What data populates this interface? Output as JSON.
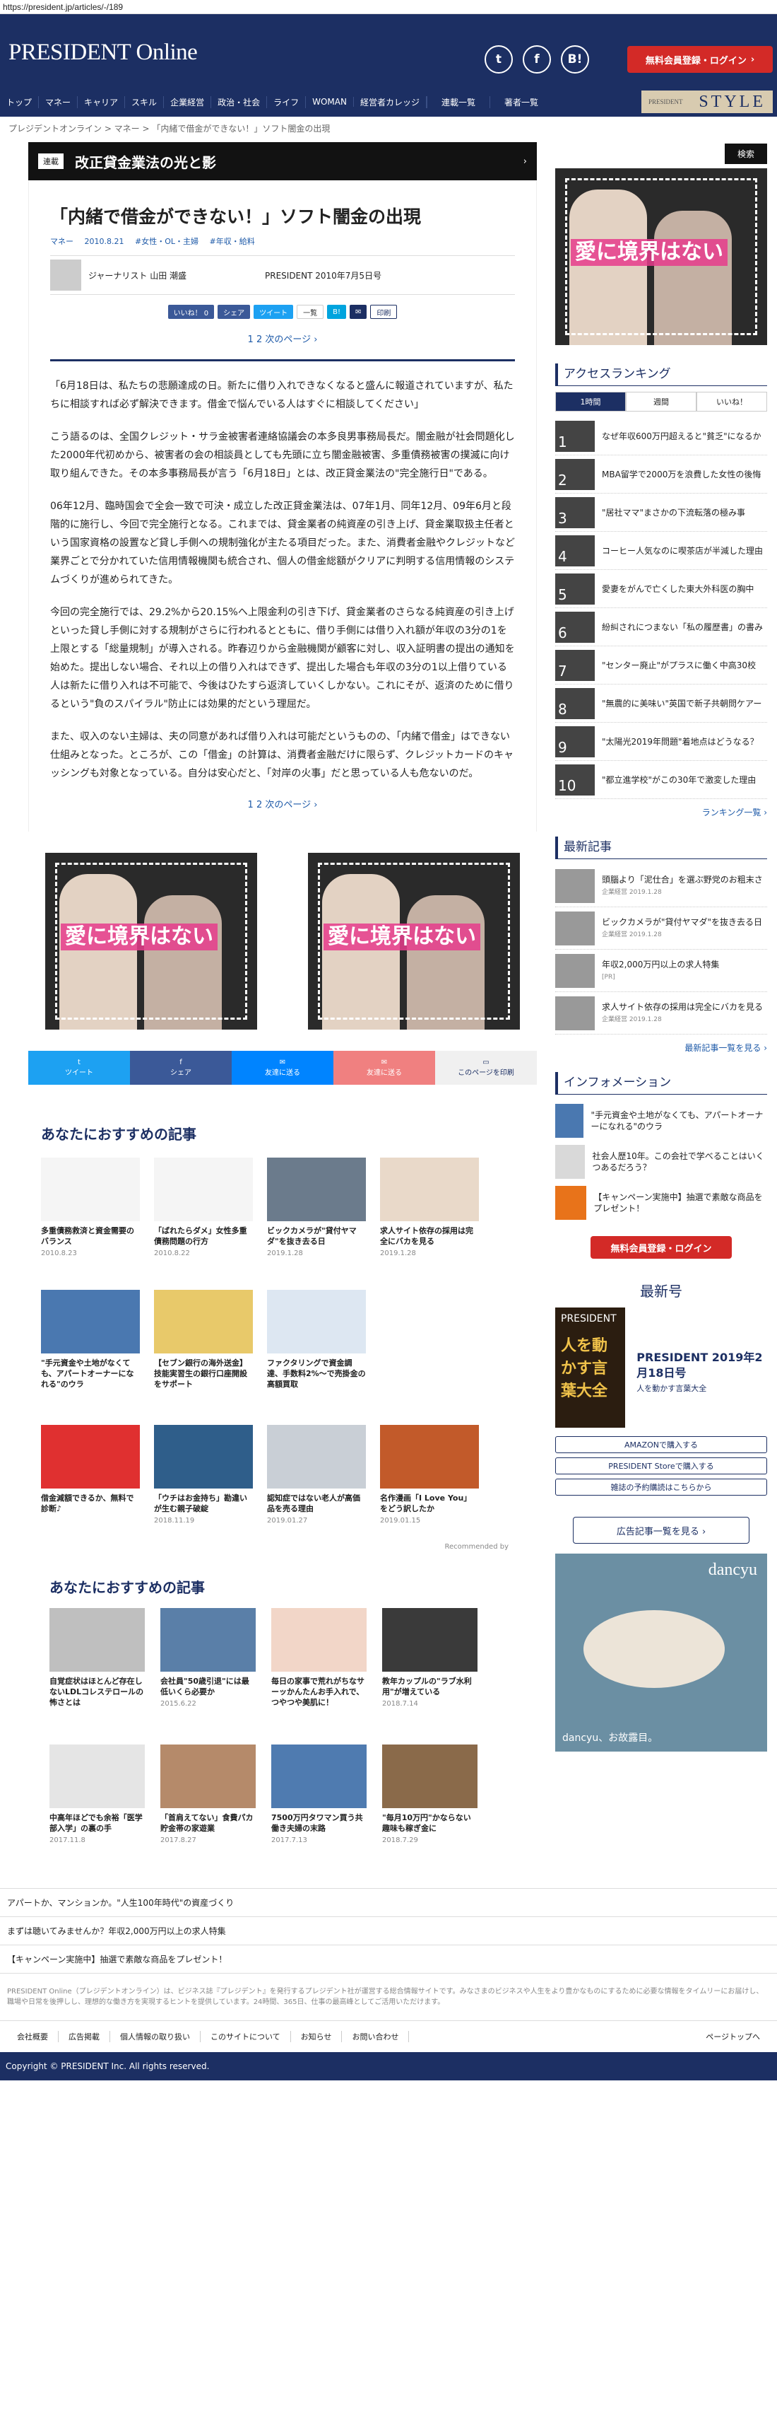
{
  "url": "https://president.jp/articles/-/189",
  "logo": "PRESIDENT Online",
  "register": "無料会員登録・ログイン",
  "nav": [
    "トップ",
    "マネー",
    "キャリア",
    "スキル",
    "企業経営",
    "政治・社会",
    "ライフ",
    "WOMAN",
    "経営者カレッジ"
  ],
  "nav_right": [
    "連載一覧",
    "著者一覧"
  ],
  "style_label": "STYLE",
  "style_small": "PRESIDENT",
  "breadcrumb": "プレジデントオンライン > マネー > 「内緒で借金ができない！」ソフト闇金の出現",
  "series_tag": "連載",
  "series_title": "改正貸金業法の光と影",
  "title": "「内緒で借金ができない！」ソフト闇金の出現",
  "meta": [
    "マネー",
    "2010.8.21",
    "#女性・OL・主婦",
    "#年収・給料"
  ],
  "author": "ジャーナリスト 山田 潮盛",
  "source": "PRESIDENT 2010年7月5日号",
  "share_buttons": [
    "いいね！ 0",
    "シェア",
    "ツイート",
    "一覧",
    "B!",
    "✉",
    "印刷"
  ],
  "pager": "1  2   次のページ ›",
  "paragraphs": [
    "「6月18日は、私たちの悲願達成の日。新たに借り入れできなくなると盛んに報道されていますが、私たちに相談すれば必ず解決できます。借金で悩んでいる人はすぐに相談してください」",
    "こう語るのは、全国クレジット・サラ金被害者連絡協議会の本多良男事務局長だ。闇金融が社会問題化した2000年代初めから、被害者の会の相談員としても先頭に立ち闇金融被害、多重債務被害の撲滅に向け取り組んできた。その本多事務局長が言う「6月18日」とは、改正貸金業法の\"完全施行日\"である。",
    "06年12月、臨時国会で全会一致で可決・成立した改正貸金業法は、07年1月、同年12月、09年6月と段階的に施行し、今回で完全施行となる。これまでは、貸金業者の純資産の引き上げ、貸金業取扱主任者という国家資格の設置など貸し手側への規制強化が主たる項目だった。また、消費者金融やクレジットなど業界ごとで分かれていた信用情報機関も統合され、個人の借金総額がクリアに判明する信用情報のシステムづくりが進められてきた。",
    "今回の完全施行では、29.2%から20.15%へ上限金利の引き下げ、貸金業者のさらなる純資産の引き上げといった貸し手側に対する規制がさらに行われるとともに、借り手側には借り入れ額が年収の3分の1を上限とする「総量規制」が導入される。昨春辺りから金融機関が顧客に対し、収入証明書の提出の通知を始めた。提出しない場合、それ以上の借り入れはできず、提出した場合も年収の3分の1以上借りている人は新たに借り入れは不可能で、今後はひたすら返済していくしかない。これにそが、返済のために借りるという\"負のスパイラル\"防止には効果的だという理屈だ。",
    "また、収入のない主婦は、夫の同意があれば借り入れは可能だというものの、「内緒で借金」はできない仕組みとなった。ところが、この「借金」の計算は、消費者金融だけに限らず、クレジットカードのキャッシングも対象となっている。自分は安心だと、「対岸の火事」だと思っている人も危ないのだ。"
  ],
  "ad_text": "愛に境界はない",
  "sharebar": [
    [
      "ツイート",
      "#1da1f2"
    ],
    [
      "シェア",
      "#3b5998"
    ],
    [
      "友達に送る",
      "#0084ff"
    ],
    [
      "友達に送る",
      "#f08080"
    ],
    [
      "このページを印刷",
      "#f0f0f0"
    ]
  ],
  "rec_title": "あなたにおすすめの記事",
  "rec_cards": [
    {
      "t": "多重債務救済と資金需要のバランス",
      "d": "2010.8.23",
      "c": "#f5f5f5"
    },
    {
      "t": "「ばれたらダメ」女性多重債務問題の行方",
      "d": "2010.8.22",
      "c": "#f5f5f5"
    },
    {
      "t": "ビックカメラが\"貸付ヤマダ\"を抜き去る日",
      "d": "2019.1.28",
      "c": "#6b7b8c"
    },
    {
      "t": "求人サイト依存の採用は完全にバカを見る",
      "d": "2019.1.28",
      "c": "#e9d9c9"
    },
    {
      "t": "\"手元資金や土地がなくても、アパートオーナーになれる\"のウラ",
      "d": "",
      "c": "#4a78b0"
    },
    {
      "t": "【セブン銀行の海外送金】技能実習生の銀行口座開設をサポート",
      "d": "",
      "c": "#e8c96a"
    },
    {
      "t": "ファクタリングで資金調達、手数料2%〜で売掛金の高額買取",
      "d": "",
      "c": "#dde7f2"
    },
    {
      "t": "",
      "d": "",
      "c": "#fff"
    },
    {
      "t": "借金減額できるか、無料で診断♪",
      "d": "",
      "c": "#e03030"
    },
    {
      "t": "「ウチはお金持ち」勘違いが生む親子破綻",
      "d": "2018.11.19",
      "c": "#2f5e8a"
    },
    {
      "t": "認知症ではない老人が高価品を売る理由",
      "d": "2019.01.27",
      "c": "#c9cfd6"
    },
    {
      "t": "名作漫画「I Love You」をどう訳したか",
      "d": "2019.01.15",
      "c": "#c25a2a"
    }
  ],
  "recommended_by": "Recommended by",
  "rec2_title": "あなたにおすすめの記事",
  "rec2_cards": [
    {
      "t": "自覚症状はほとんど存在しないLDLコレステロールの怖さとは",
      "d": "",
      "c": "#bfbfbf"
    },
    {
      "t": "会社員\"50歳引退\"には最低いくら必要か",
      "d": "2015.6.22",
      "c": "#5a7fa8"
    },
    {
      "t": "毎日の家事で荒れがちなサーッかんたんお手入れで、つやつや美肌に！",
      "d": "",
      "c": "#f2d6c8"
    },
    {
      "t": "教年カップルの\"ラブ水利用\"が増えている",
      "d": "2018.7.14",
      "c": "#3a3a3a"
    },
    {
      "t": "中高年ほどでも余裕「医学部入学」の裏の手",
      "d": "2017.11.8",
      "c": "#e5e5e5"
    },
    {
      "t": "「首肩えてない」食費パカ貯金帯の家遊業",
      "d": "2017.8.27",
      "c": "#b58a6a"
    },
    {
      "t": "7500万円タワマン買う共働き夫婦の末路",
      "d": "2017.7.13",
      "c": "#4f7bb0"
    },
    {
      "t": "\"毎月10万円\"かならない趣味も稼ぎ金に",
      "d": "2018.7.29",
      "c": "#8a6a4a"
    }
  ],
  "bottom_links": [
    "アパートか、マンションか。\"人生100年時代\"の資産づくり",
    "まずは聴いてみませんか？年収2,000万円以上の求人特集",
    "【キャンペーン実施中】抽選で素敵な商品をプレゼント！"
  ],
  "disclaimer": "PRESIDENT Online（プレジデントオンライン）は、ビジネス誌『プレジデント』を発行するプレジデント社が運営する総合情報サイトです。みなさまのビジネスや人生をより豊かなものにするために必要な情報をタイムリーにお届けし、職場や日常を後押しし、理想的な働き方を実現するヒントを提供しています。24時間、365日、仕事の最高峰としてご活用いただけます。",
  "footer_links": [
    "会社概要",
    "広告掲載",
    "個人情報の取り扱い",
    "このサイトについて",
    "お知らせ",
    "お問い合わせ"
  ],
  "page_top": "ページトップへ",
  "copyright": "Copyright © PRESIDENT Inc. All rights reserved.",
  "search": "検索",
  "ranking_title": "アクセスランキング",
  "ranking_tabs": [
    "1時間",
    "週間",
    "いいね！"
  ],
  "ranking": [
    "なぜ年収600万円超えると\"貧乏\"になるか",
    "MBA留学で2000万を浪費した女性の後悔",
    "\"居社ママ\"まさかの下流転落の極み事",
    "コーヒー人気なのに喫茶店が半減した理由",
    "愛妻をがんで亡くした東大外科医の胸中",
    "紛糾されにつまない「私の履歴書」の書み",
    "\"センター廃止\"がプラスに働く中高30校",
    "\"無農的に美味い\"英国で新子共朝問ケアー",
    "\"太陽光2019年問題\"着地点はどうなる？",
    "\"都立進学校\"がこの30年で激変した理由"
  ],
  "ranking_more": "ランキング一覧 ›",
  "latest_title": "最新記事",
  "latest": [
    {
      "t": "頭腦より「泥仕合」を選ぶ野党のお粗末さ",
      "d": "企業経営 2019.1.28"
    },
    {
      "t": "ビックカメラが\"貸付ヤマダ\"を抜き去る日",
      "d": "企業経営 2019.1.28"
    },
    {
      "t": "年収2,000万円以上の求人特集",
      "d": "[PR]"
    },
    {
      "t": "求人サイト依存の採用は完全にバカを見る",
      "d": "企業経営 2019.1.28"
    }
  ],
  "latest_more": "最新記事一覧を見る ›",
  "info_title": "インフォメーション",
  "info": [
    "\"手元資金や土地がなくても、アパートオーナーになれる\"のウラ",
    "社会人歴10年。この会社で学べることはいくつあるだろう？",
    "【キャンペーン実施中】抽選で素敵な商品をプレゼント！"
  ],
  "new_issue": "最新号",
  "cover_top": "PRESIDENT",
  "cover_big": "人を動かす言葉大全",
  "mag_title": "PRESIDENT 2019年2月18日号",
  "mag_sub": "人を動かす言葉大全",
  "store_buttons": [
    "AMAZONで購入する",
    "PRESIDENT Storeで購入する",
    "雑誌の予約購読はこちらから"
  ],
  "ad_link": "広告記事一覧を見る ›",
  "dancyu_logo": "dancyu",
  "dancyu_text": "dancyu、お故露目。"
}
